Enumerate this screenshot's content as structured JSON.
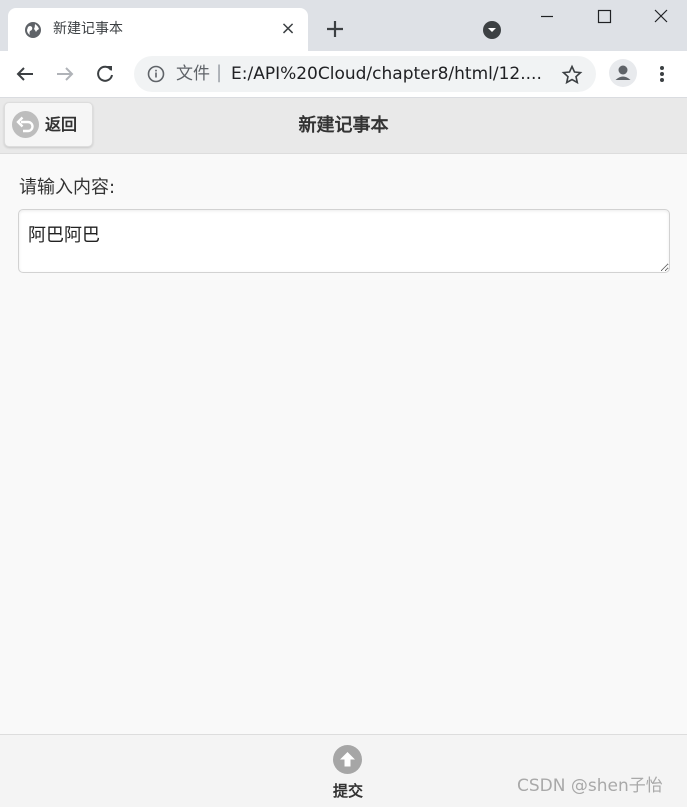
{
  "browser": {
    "tab_title": "新建记事本",
    "tab_close": "×",
    "url_prefix": "文件",
    "url_separator": "|",
    "url": "E:/API%20Cloud/chapter8/html/12...."
  },
  "header": {
    "back_label": "返回",
    "title": "新建记事本"
  },
  "form": {
    "label": "请输入内容:",
    "value": "阿巴阿巴"
  },
  "footer": {
    "submit_label": "提交",
    "watermark": "CSDN @shen子怡"
  },
  "colors": {
    "tabstrip": "#dee1e6",
    "header_bg": "#e9e9e9",
    "page_bg": "#f9f9f9",
    "icon_gray": "#a6a6a6"
  }
}
